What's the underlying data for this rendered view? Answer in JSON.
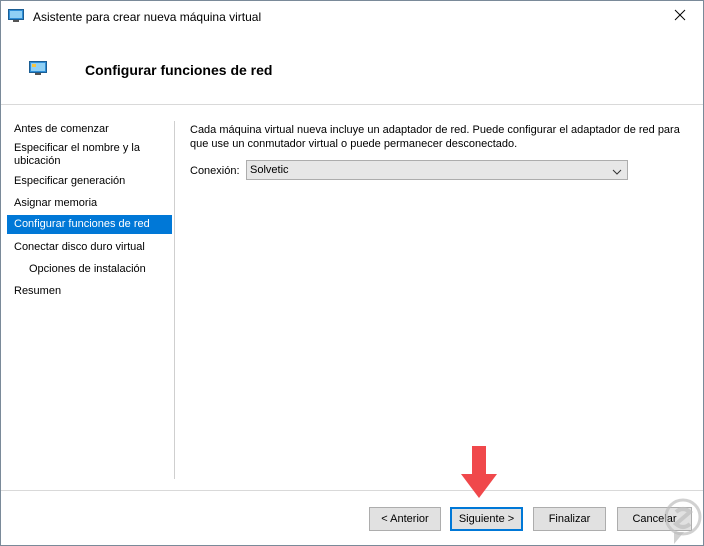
{
  "window": {
    "title": "Asistente para crear nueva máquina virtual",
    "page_title": "Configurar funciones de red",
    "accent_color": "#0078d7"
  },
  "nav": {
    "items": [
      {
        "label": "Antes de comenzar"
      },
      {
        "label": "Especificar el nombre y la ubicación"
      },
      {
        "label": "Especificar generación"
      },
      {
        "label": "Asignar memoria"
      },
      {
        "label": "Configurar funciones de red",
        "selected": true
      },
      {
        "label": "Conectar disco duro virtual"
      },
      {
        "label": "Opciones de instalación"
      },
      {
        "label": "Resumen"
      }
    ]
  },
  "content": {
    "description": "Cada máquina virtual nueva incluye un adaptador de red. Puede configurar el adaptador de red para que use un conmutador virtual o puede permanecer desconectado.",
    "connection_label": "Conexión:",
    "connection_value": "Solvetic"
  },
  "buttons": {
    "previous": "< Anterior",
    "next": "Siguiente >",
    "finish": "Finalizar",
    "cancel": "Cancelar"
  },
  "icons": {
    "app": "hyperv-vm-icon",
    "close": "close-icon",
    "dropdown": "chevron-down-icon",
    "pointer": "red-arrow-icon"
  }
}
